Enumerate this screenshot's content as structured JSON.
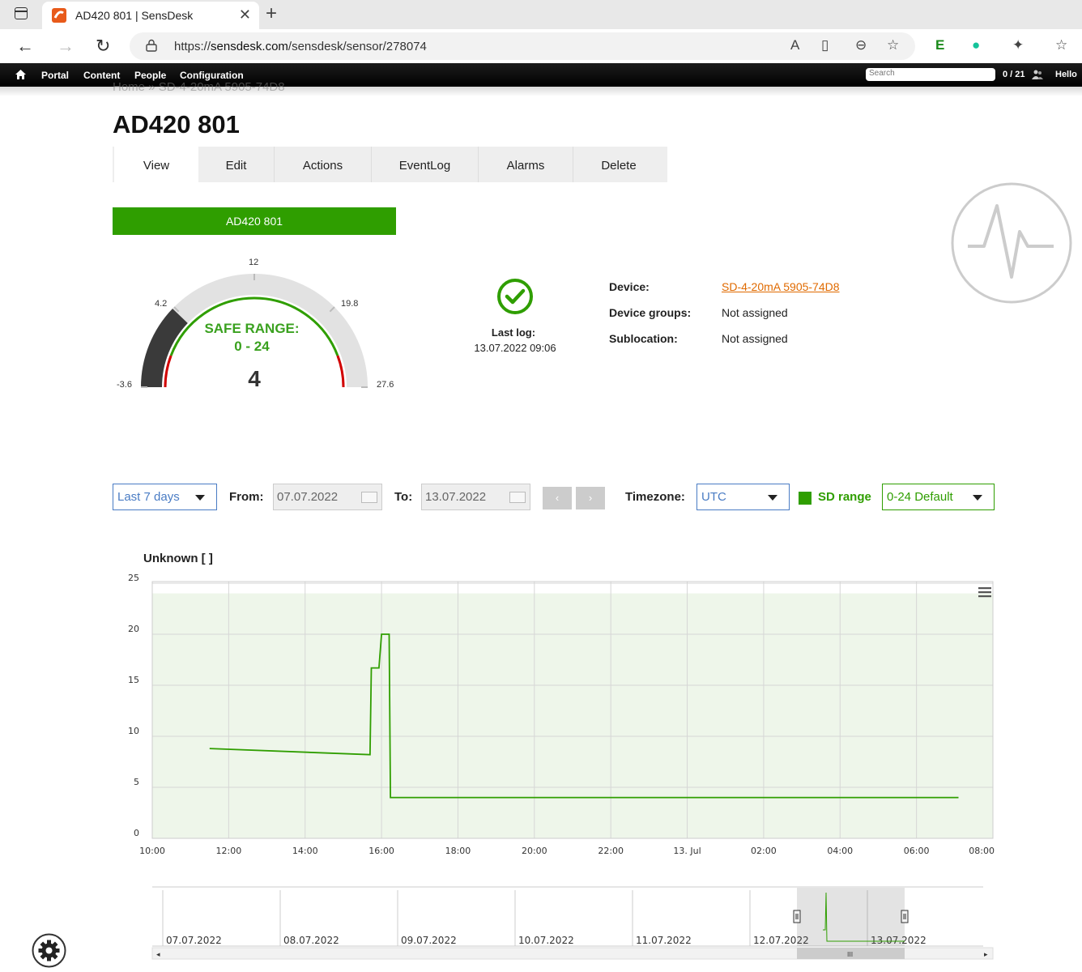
{
  "browser": {
    "tab_title": "AD420 801 | SensDesk",
    "url_prefix": "https://",
    "url_host": "sensdesk.com",
    "url_path": "/sensdesk/sensor/278074"
  },
  "sitenav": {
    "items": [
      "Portal",
      "Content",
      "People",
      "Configuration"
    ],
    "search_placeholder": "Search",
    "user_count": "0 / 21",
    "greeting": "Hello"
  },
  "breadcrumb": "Home » SD-4-20mA 5905-74D8",
  "page_title": "AD420 801",
  "tabs": [
    "View",
    "Edit",
    "Actions",
    "EventLog",
    "Alarms",
    "Delete"
  ],
  "sensor_name": "AD420 801",
  "gauge": {
    "min": -3.6,
    "max": 27.6,
    "ticks": [
      "-3.6",
      "4.2",
      "12",
      "19.8",
      "27.6"
    ],
    "safe_label": "SAFE RANGE:",
    "safe_range": "0 - 24",
    "safe_min": 0,
    "safe_max": 24,
    "value": "4",
    "value_num": 4
  },
  "last_log": {
    "label": "Last log:",
    "value": "13.07.2022 09:06"
  },
  "details": [
    {
      "key": "Device:",
      "value": "SD-4-20mA 5905-74D8",
      "link": true
    },
    {
      "key": "Device groups:",
      "value": "Not assigned",
      "link": false
    },
    {
      "key": "Sublocation:",
      "value": "Not assigned",
      "link": false
    }
  ],
  "controls": {
    "period": "Last 7 days",
    "from_label": "From:",
    "from_value": "07.07.2022",
    "to_label": "To:",
    "to_value": "13.07.2022",
    "prev": "‹",
    "next": "›",
    "timezone_label": "Timezone:",
    "timezone_value": "UTC",
    "sd_range_label": "SD range",
    "sd_range_value": "0-24 Default"
  },
  "colors": {
    "green": "#2f9e00",
    "nav": "#000000",
    "link": "#e06a00",
    "blue": "#4a7cc4"
  },
  "chart_data": {
    "type": "line",
    "title": "Unknown [ ]",
    "ylim": [
      0,
      25
    ],
    "yticks": [
      "0",
      "5",
      "10",
      "15",
      "20",
      "25"
    ],
    "xlim": [
      "12.07.2022 10:00",
      "13.07.2022 08:00"
    ],
    "xticks": [
      "10:00",
      "12:00",
      "14:00",
      "16:00",
      "18:00",
      "20:00",
      "22:00",
      "13. Jul",
      "02:00",
      "04:00",
      "06:00",
      "08:00"
    ],
    "safe_band": [
      0,
      24
    ],
    "grid": true,
    "series": [
      {
        "points": [
          [
            "12.07.2022 11:30",
            8.8
          ],
          [
            "12.07.2022 15:42",
            8.2
          ],
          [
            "12.07.2022 15:44",
            16.7
          ],
          [
            "12.07.2022 15:56",
            16.7
          ],
          [
            "12.07.2022 16:00",
            20.0
          ],
          [
            "12.07.2022 16:12",
            20.0
          ],
          [
            "12.07.2022 16:14",
            4.0
          ],
          [
            "13.07.2022 07:06",
            4.0
          ]
        ]
      }
    ],
    "navigator": {
      "dates": [
        "07.07.2022",
        "08.07.2022",
        "09.07.2022",
        "10.07.2022",
        "11.07.2022",
        "12.07.2022",
        "13.07.2022"
      ]
    }
  }
}
